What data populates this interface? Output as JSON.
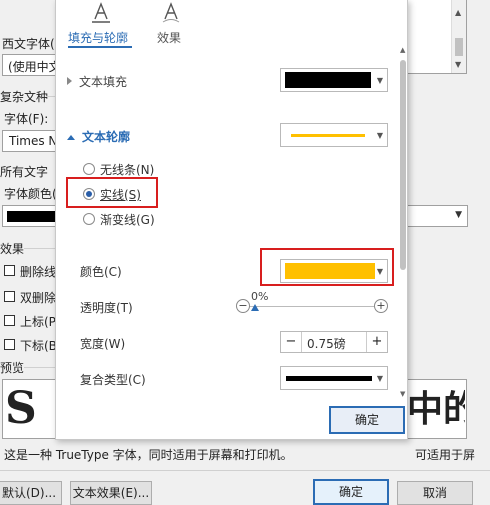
{
  "background_dialog": {
    "western_font_label": "西文字体(",
    "western_font_value": "(使用中文",
    "complex_script_label": "复杂文种",
    "complex_font_label": "字体(F):",
    "complex_font_value": "Times N",
    "all_text_label": "所有文字",
    "font_color_label": "字体颜色(",
    "effects_label": "效果",
    "strikethrough_label": "删除线",
    "double_strike_label": "双删除",
    "superscript_label": "上标(P",
    "subscript_label": "下标(B",
    "preview_label": "预览",
    "preview_right_text": "中的",
    "truetype_note": "这是一种 TrueType 字体，同时适用于屏幕和打印机。",
    "truetype_note_right": "可适用于屏",
    "default_button": "默认(D)...",
    "text_effects_button": "文本效果(E)...",
    "ok_button": "确定",
    "cancel_button": "取消"
  },
  "panel": {
    "tabs": [
      {
        "label": "填充与轮廓",
        "active": true,
        "icon": "text-fill-outline-icon"
      },
      {
        "label": "效果",
        "active": false,
        "icon": "text-effects-icon"
      }
    ],
    "text_fill": {
      "title": "文本填充",
      "expanded": false,
      "color": "#000000"
    },
    "text_outline": {
      "title": "文本轮廓",
      "expanded": true,
      "preview_color": "#ffc000",
      "options": [
        {
          "label": "无线条(N)",
          "selected": false
        },
        {
          "label": "实线(S)",
          "selected": true
        },
        {
          "label": "渐变线(G)",
          "selected": false
        }
      ],
      "color_label": "颜色(C)",
      "color_value": "#ffc000",
      "transparency_label": "透明度(T)",
      "transparency_value": "0%",
      "width_label": "宽度(W)",
      "width_value": "0.75磅",
      "compound_label": "复合类型(C)"
    },
    "ok_button": "确定"
  },
  "colors": {
    "accent_blue": "#2b6cb4",
    "highlight_red": "#d81e1e",
    "outline_yellow": "#ffc000"
  }
}
